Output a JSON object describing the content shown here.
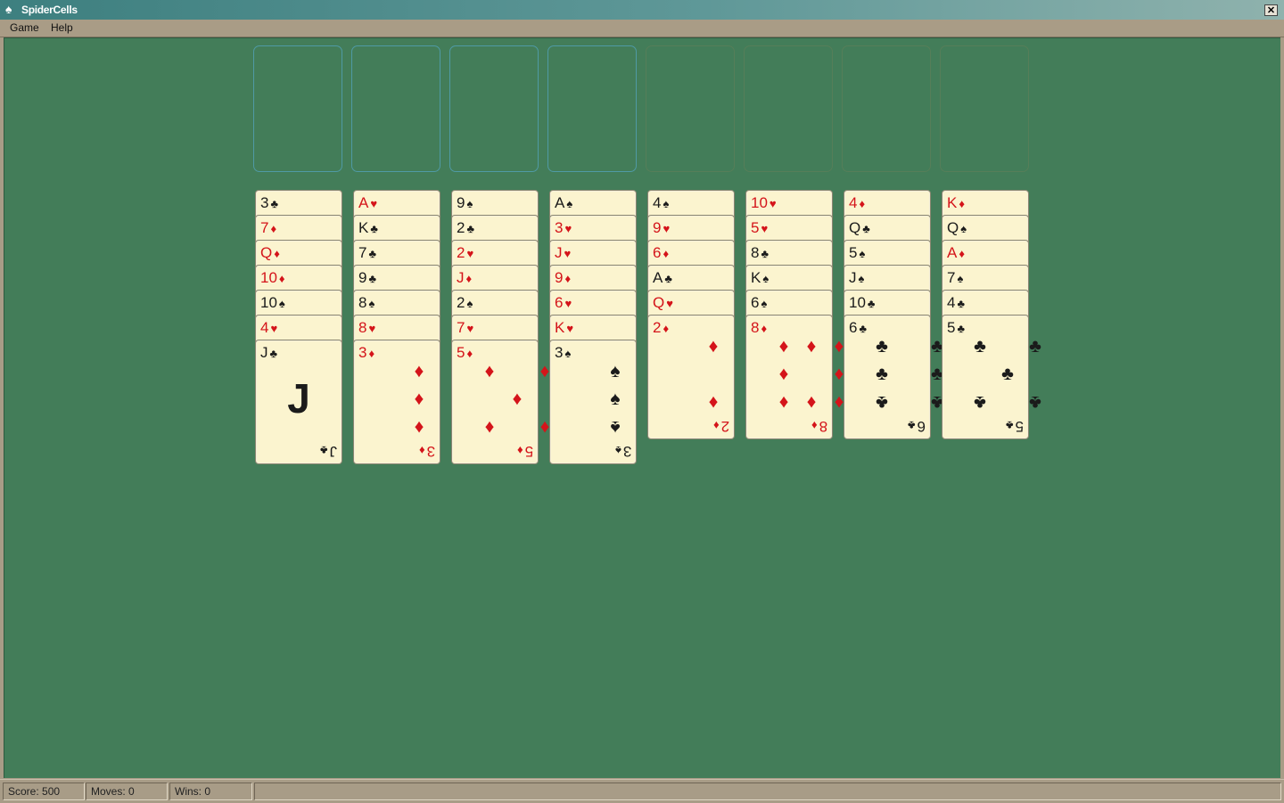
{
  "window": {
    "title": "SpiderCells",
    "icon": "spade-icon",
    "close_label": "✕"
  },
  "menu": {
    "items": [
      "Game",
      "Help"
    ]
  },
  "colors": {
    "felt": "#437d59",
    "card_face": "#fbf4cf",
    "red_suit": "#d4141a",
    "black_suit": "#1b1b1b",
    "free_cell_outline": "#4f9aa4",
    "foundation_outline": "#567e59"
  },
  "cells": {
    "free_cells": 4,
    "foundations": 4
  },
  "tableau": [
    [
      {
        "r": "3",
        "s": "♣"
      },
      {
        "r": "7",
        "s": "♦"
      },
      {
        "r": "Q",
        "s": "♦"
      },
      {
        "r": "10",
        "s": "♦"
      },
      {
        "r": "10",
        "s": "♠"
      },
      {
        "r": "4",
        "s": "♥"
      },
      {
        "r": "J",
        "s": "♣"
      }
    ],
    [
      {
        "r": "A",
        "s": "♥"
      },
      {
        "r": "K",
        "s": "♣"
      },
      {
        "r": "7",
        "s": "♣"
      },
      {
        "r": "9",
        "s": "♣"
      },
      {
        "r": "8",
        "s": "♠"
      },
      {
        "r": "8",
        "s": "♥"
      },
      {
        "r": "3",
        "s": "♦"
      }
    ],
    [
      {
        "r": "9",
        "s": "♠"
      },
      {
        "r": "2",
        "s": "♣"
      },
      {
        "r": "2",
        "s": "♥"
      },
      {
        "r": "J",
        "s": "♦"
      },
      {
        "r": "2",
        "s": "♠"
      },
      {
        "r": "7",
        "s": "♥"
      },
      {
        "r": "5",
        "s": "♦"
      }
    ],
    [
      {
        "r": "A",
        "s": "♠"
      },
      {
        "r": "3",
        "s": "♥"
      },
      {
        "r": "J",
        "s": "♥"
      },
      {
        "r": "9",
        "s": "♦"
      },
      {
        "r": "6",
        "s": "♥"
      },
      {
        "r": "K",
        "s": "♥"
      },
      {
        "r": "3",
        "s": "♠"
      }
    ],
    [
      {
        "r": "4",
        "s": "♠"
      },
      {
        "r": "9",
        "s": "♥"
      },
      {
        "r": "6",
        "s": "♦"
      },
      {
        "r": "A",
        "s": "♣"
      },
      {
        "r": "Q",
        "s": "♥"
      },
      {
        "r": "2",
        "s": "♦"
      }
    ],
    [
      {
        "r": "10",
        "s": "♥"
      },
      {
        "r": "5",
        "s": "♥"
      },
      {
        "r": "8",
        "s": "♣"
      },
      {
        "r": "K",
        "s": "♠"
      },
      {
        "r": "6",
        "s": "♠"
      },
      {
        "r": "8",
        "s": "♦"
      }
    ],
    [
      {
        "r": "4",
        "s": "♦"
      },
      {
        "r": "Q",
        "s": "♣"
      },
      {
        "r": "5",
        "s": "♠"
      },
      {
        "r": "J",
        "s": "♠"
      },
      {
        "r": "10",
        "s": "♣"
      },
      {
        "r": "6",
        "s": "♣"
      }
    ],
    [
      {
        "r": "K",
        "s": "♦"
      },
      {
        "r": "Q",
        "s": "♠"
      },
      {
        "r": "A",
        "s": "♦"
      },
      {
        "r": "7",
        "s": "♠"
      },
      {
        "r": "4",
        "s": "♣"
      },
      {
        "r": "5",
        "s": "♣"
      }
    ]
  ],
  "status": {
    "score": "Score: 500",
    "moves": "Moves: 0",
    "wins": "Wins: 0",
    "empty": ""
  }
}
